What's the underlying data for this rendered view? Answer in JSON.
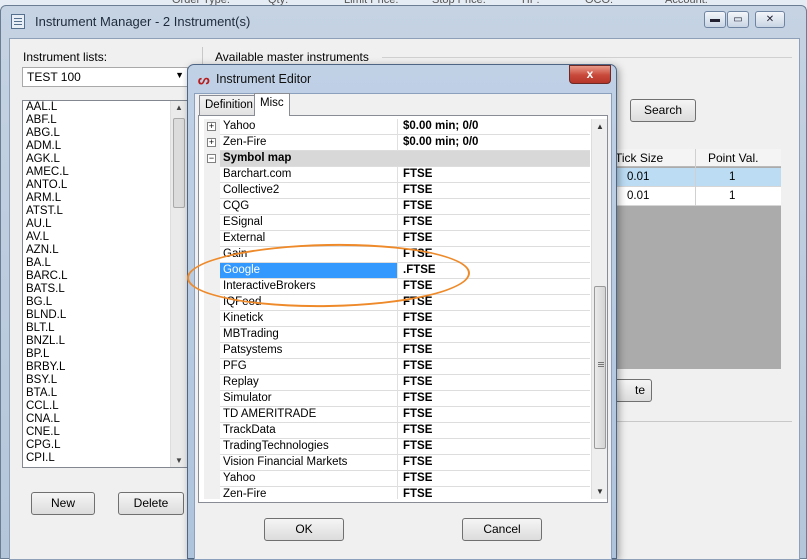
{
  "background_bar": {
    "labels": [
      "Order Type:",
      "Qty:",
      "Limit Price:",
      "Stop Price:",
      "TIF:",
      "OCO:",
      "Account:"
    ]
  },
  "main_window": {
    "title": "Instrument Manager - 2 Instrument(s)",
    "controls": {
      "minimize": "▬",
      "maximize": "▭",
      "close": "✕"
    },
    "instrument_lists_label": "Instrument lists:",
    "selected_list": "TEST 100",
    "instruments": [
      "AAL.L",
      "ABF.L",
      "ABG.L",
      "ADM.L",
      "AGK.L",
      "AMEC.L",
      "ANTO.L",
      "ARM.L",
      "ATST.L",
      "AU.L",
      "AV.L",
      "AZN.L",
      "BA.L",
      "BARC.L",
      "BATS.L",
      "BG.L",
      "BLND.L",
      "BLT.L",
      "BNZL.L",
      "BP.L",
      "BRBY.L",
      "BSY.L",
      "BTA.L",
      "CCL.L",
      "CNA.L",
      "CNE.L",
      "CPG.L",
      "CPI.L"
    ],
    "new_button": "New",
    "delete_button": "Delete",
    "available_master_label": "Available master instruments",
    "search_button": "Search",
    "grid": {
      "columns": [
        "Tick Size",
        "Point Val."
      ],
      "rows": [
        [
          "0.01",
          "1"
        ],
        [
          "0.01",
          "1"
        ]
      ]
    },
    "partial_button": "te"
  },
  "dialog": {
    "title": "Instrument Editor",
    "close_glyph": "x",
    "tabs": [
      {
        "label": "Definition"
      },
      {
        "label": "Misc"
      }
    ],
    "active_tab": "Misc",
    "rows": [
      {
        "kind": "expandable",
        "name": "Yahoo",
        "value": "$0.00 min;  0/0"
      },
      {
        "kind": "expandable",
        "name": "Zen-Fire",
        "value": "$0.00 min;  0/0"
      },
      {
        "kind": "category",
        "name": "Symbol map",
        "value": ""
      },
      {
        "kind": "item",
        "name": "Barchart.com",
        "value": "FTSE"
      },
      {
        "kind": "item",
        "name": "Collective2",
        "value": "FTSE"
      },
      {
        "kind": "item",
        "name": "CQG",
        "value": "FTSE"
      },
      {
        "kind": "item",
        "name": "ESignal",
        "value": "FTSE"
      },
      {
        "kind": "item",
        "name": "External",
        "value": "FTSE"
      },
      {
        "kind": "item",
        "name": "Gain",
        "value": "FTSE"
      },
      {
        "kind": "selected",
        "name": "Google",
        "value": ".FTSE"
      },
      {
        "kind": "item",
        "name": "InteractiveBrokers",
        "value": "FTSE"
      },
      {
        "kind": "item",
        "name": "IQFeed",
        "value": "FTSE"
      },
      {
        "kind": "item",
        "name": "Kinetick",
        "value": "FTSE"
      },
      {
        "kind": "item",
        "name": "MBTrading",
        "value": "FTSE"
      },
      {
        "kind": "item",
        "name": "Patsystems",
        "value": "FTSE"
      },
      {
        "kind": "item",
        "name": "PFG",
        "value": "FTSE"
      },
      {
        "kind": "item",
        "name": "Replay",
        "value": "FTSE"
      },
      {
        "kind": "item",
        "name": "Simulator",
        "value": "FTSE"
      },
      {
        "kind": "item",
        "name": "TD AMERITRADE",
        "value": "FTSE"
      },
      {
        "kind": "item",
        "name": "TrackData",
        "value": "FTSE"
      },
      {
        "kind": "item",
        "name": "TradingTechnologies",
        "value": "FTSE"
      },
      {
        "kind": "item",
        "name": "Vision Financial Markets",
        "value": "FTSE"
      },
      {
        "kind": "item",
        "name": "Yahoo",
        "value": "FTSE"
      },
      {
        "kind": "item",
        "name": "Zen-Fire",
        "value": "FTSE"
      }
    ],
    "ok_button": "OK",
    "cancel_button": "Cancel"
  },
  "annotation": {
    "color": "#ee8a2a",
    "target": "Google"
  },
  "colors": {
    "selection": "#3399ff",
    "grid_selected_row": "#bcdcf4",
    "close_button": "#c8483a"
  }
}
